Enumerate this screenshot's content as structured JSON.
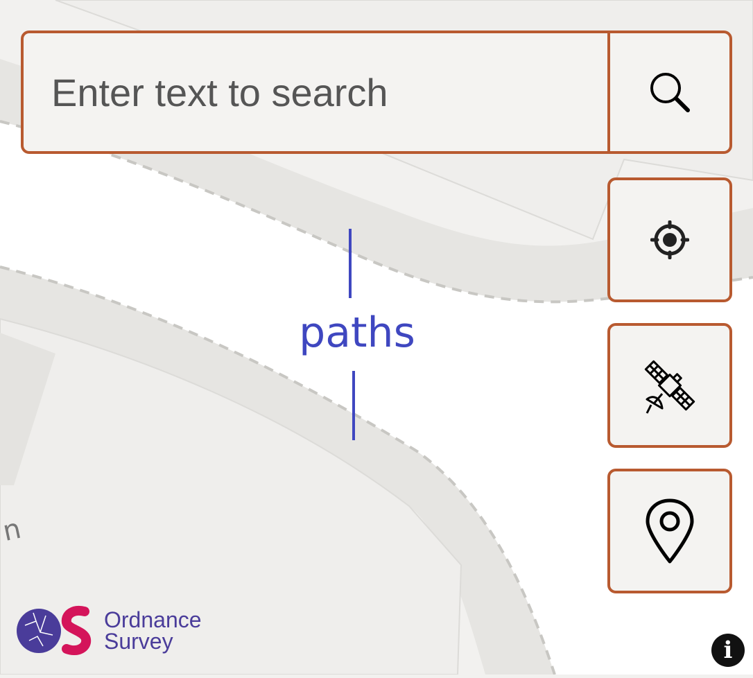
{
  "map": {
    "path_label": "paths",
    "road_label_fragment": "n"
  },
  "search": {
    "placeholder": "Enter text to search",
    "value": "",
    "button_icon": "search-icon"
  },
  "controls": {
    "locate_icon": "crosshair-icon",
    "satellite_icon": "satellite-icon",
    "marker_icon": "map-pin-icon",
    "info_icon": "info-icon",
    "info_glyph": "i"
  },
  "logo": {
    "line1": "Ordnance",
    "line2": "Survey"
  },
  "colors": {
    "control_border": "#b85a30",
    "control_fill": "#f4f3f1",
    "label": "#3f47c0",
    "logo_purple": "#4a3c9a",
    "logo_magenta": "#d4145a"
  }
}
